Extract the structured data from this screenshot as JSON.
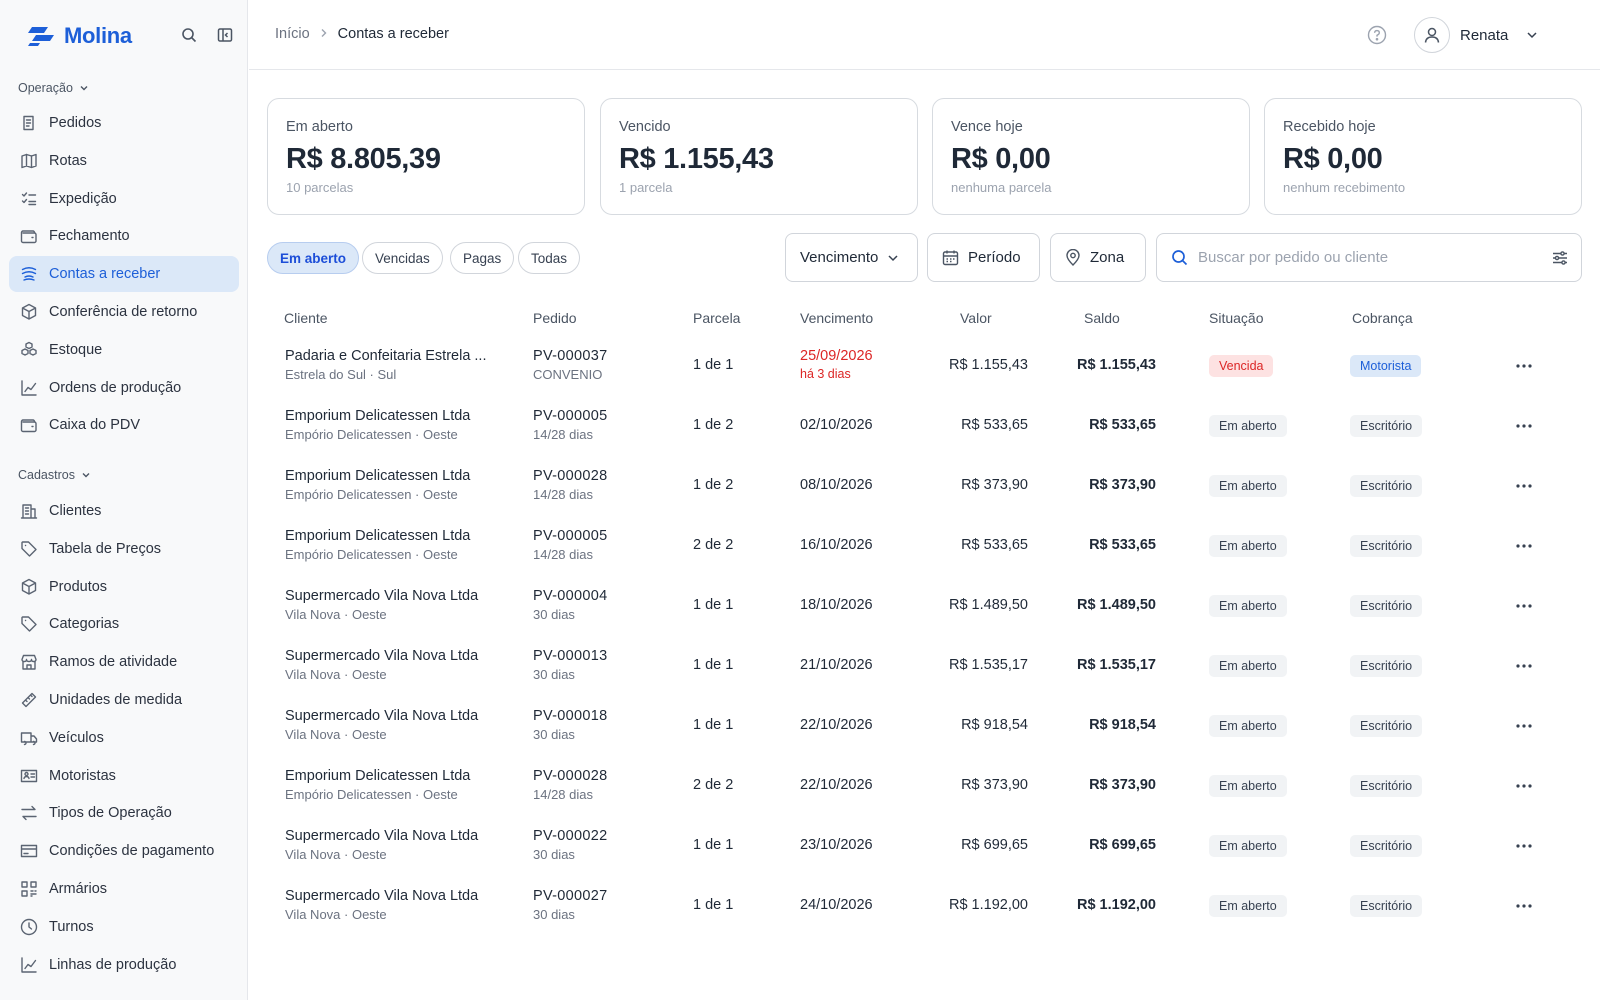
{
  "brand": {
    "name": "Molina",
    "color": "#1d5fd8"
  },
  "sidebar": {
    "sections": [
      {
        "label": "Operação",
        "items": [
          {
            "label": "Pedidos",
            "icon": "orders-icon"
          },
          {
            "label": "Rotas",
            "icon": "map-icon"
          },
          {
            "label": "Expedição",
            "icon": "checklist-icon"
          },
          {
            "label": "Fechamento",
            "icon": "wallet-icon"
          },
          {
            "label": "Contas a receber",
            "icon": "coins-icon",
            "active": true
          },
          {
            "label": "Conferência de retorno",
            "icon": "box-icon"
          },
          {
            "label": "Estoque",
            "icon": "boxes-icon"
          },
          {
            "label": "Ordens de produção",
            "icon": "chart-icon"
          },
          {
            "label": "Caixa do PDV",
            "icon": "wallet-icon"
          }
        ]
      },
      {
        "label": "Cadastros",
        "items": [
          {
            "label": "Clientes",
            "icon": "building-icon"
          },
          {
            "label": "Tabela de Preços",
            "icon": "tag-icon"
          },
          {
            "label": "Produtos",
            "icon": "box-icon"
          },
          {
            "label": "Categorias",
            "icon": "tag-icon"
          },
          {
            "label": "Ramos de atividade",
            "icon": "store-icon"
          },
          {
            "label": "Unidades de medida",
            "icon": "ruler-icon"
          },
          {
            "label": "Veículos",
            "icon": "truck-icon"
          },
          {
            "label": "Motoristas",
            "icon": "id-card-icon"
          },
          {
            "label": "Tipos de Operação",
            "icon": "swap-icon"
          },
          {
            "label": "Condições de pagamento",
            "icon": "card-icon"
          },
          {
            "label": "Armários",
            "icon": "grid-icon"
          },
          {
            "label": "Turnos",
            "icon": "clock-icon"
          },
          {
            "label": "Linhas de produção",
            "icon": "chart-icon"
          }
        ]
      }
    ]
  },
  "header": {
    "breadcrumb": [
      "Início",
      "Contas a receber"
    ],
    "user": "Renata"
  },
  "cards": [
    {
      "title": "Em aberto",
      "value": "R$ 8.805,39",
      "sub": "10 parcelas"
    },
    {
      "title": "Vencido",
      "value": "R$ 1.155,43",
      "sub": "1 parcela"
    },
    {
      "title": "Vence hoje",
      "value": "R$ 0,00",
      "sub": "nenhuma parcela"
    },
    {
      "title": "Recebido hoje",
      "value": "R$ 0,00",
      "sub": "nenhum recebimento"
    }
  ],
  "filters": {
    "tabs": [
      "Em aberto",
      "Vencidas",
      "Pagas",
      "Todas"
    ],
    "active_tab": "Em aberto",
    "sort": "Vencimento",
    "period": "Período",
    "zone": "Zona",
    "search_placeholder": "Buscar por pedido ou cliente"
  },
  "table": {
    "columns": [
      "Cliente",
      "Pedido",
      "Parcela",
      "Vencimento",
      "Valor",
      "Saldo",
      "Situação",
      "Cobrança"
    ],
    "rows": [
      {
        "cliente": "Padaria e Confeitaria Estrela ...",
        "local": "Estrela do Sul · Sul",
        "pedido": "PV-000037",
        "cond": "CONVENIO",
        "parcela": "1 de 1",
        "vencimento": "25/09/2026",
        "atraso": "há 3 dias",
        "valor": "R$ 1.155,43",
        "saldo": "R$ 1.155,43",
        "situacao": "Vencida",
        "cobranca": "Motorista",
        "overdue": true
      },
      {
        "cliente": "Emporium Delicatessen Ltda",
        "local": "Empório Delicatessen · Oeste",
        "pedido": "PV-000005",
        "cond": "14/28 dias",
        "parcela": "1 de 2",
        "vencimento": "02/10/2026",
        "valor": "R$ 533,65",
        "saldo": "R$ 533,65",
        "situacao": "Em aberto",
        "cobranca": "Escritório"
      },
      {
        "cliente": "Emporium Delicatessen Ltda",
        "local": "Empório Delicatessen · Oeste",
        "pedido": "PV-000028",
        "cond": "14/28 dias",
        "parcela": "1 de 2",
        "vencimento": "08/10/2026",
        "valor": "R$ 373,90",
        "saldo": "R$ 373,90",
        "situacao": "Em aberto",
        "cobranca": "Escritório"
      },
      {
        "cliente": "Emporium Delicatessen Ltda",
        "local": "Empório Delicatessen · Oeste",
        "pedido": "PV-000005",
        "cond": "14/28 dias",
        "parcela": "2 de 2",
        "vencimento": "16/10/2026",
        "valor": "R$ 533,65",
        "saldo": "R$ 533,65",
        "situacao": "Em aberto",
        "cobranca": "Escritório"
      },
      {
        "cliente": "Supermercado Vila Nova Ltda",
        "local": "Vila Nova · Oeste",
        "pedido": "PV-000004",
        "cond": "30 dias",
        "parcela": "1 de 1",
        "vencimento": "18/10/2026",
        "valor": "R$ 1.489,50",
        "saldo": "R$ 1.489,50",
        "situacao": "Em aberto",
        "cobranca": "Escritório"
      },
      {
        "cliente": "Supermercado Vila Nova Ltda",
        "local": "Vila Nova · Oeste",
        "pedido": "PV-000013",
        "cond": "30 dias",
        "parcela": "1 de 1",
        "vencimento": "21/10/2026",
        "valor": "R$ 1.535,17",
        "saldo": "R$ 1.535,17",
        "situacao": "Em aberto",
        "cobranca": "Escritório"
      },
      {
        "cliente": "Supermercado Vila Nova Ltda",
        "local": "Vila Nova · Oeste",
        "pedido": "PV-000018",
        "cond": "30 dias",
        "parcela": "1 de 1",
        "vencimento": "22/10/2026",
        "valor": "R$ 918,54",
        "saldo": "R$ 918,54",
        "situacao": "Em aberto",
        "cobranca": "Escritório"
      },
      {
        "cliente": "Emporium Delicatessen Ltda",
        "local": "Empório Delicatessen · Oeste",
        "pedido": "PV-000028",
        "cond": "14/28 dias",
        "parcela": "2 de 2",
        "vencimento": "22/10/2026",
        "valor": "R$ 373,90",
        "saldo": "R$ 373,90",
        "situacao": "Em aberto",
        "cobranca": "Escritório"
      },
      {
        "cliente": "Supermercado Vila Nova Ltda",
        "local": "Vila Nova · Oeste",
        "pedido": "PV-000022",
        "cond": "30 dias",
        "parcela": "1 de 1",
        "vencimento": "23/10/2026",
        "valor": "R$ 699,65",
        "saldo": "R$ 699,65",
        "situacao": "Em aberto",
        "cobranca": "Escritório"
      },
      {
        "cliente": "Supermercado Vila Nova Ltda",
        "local": "Vila Nova · Oeste",
        "pedido": "PV-000027",
        "cond": "30 dias",
        "parcela": "1 de 1",
        "vencimento": "24/10/2026",
        "valor": "R$ 1.192,00",
        "saldo": "R$ 1.192,00",
        "situacao": "Em aberto",
        "cobranca": "Escritório"
      }
    ]
  },
  "colors": {
    "accent": "#1d5fd8",
    "danger": "#dc2626",
    "active_bg": "#dbe8f8"
  }
}
